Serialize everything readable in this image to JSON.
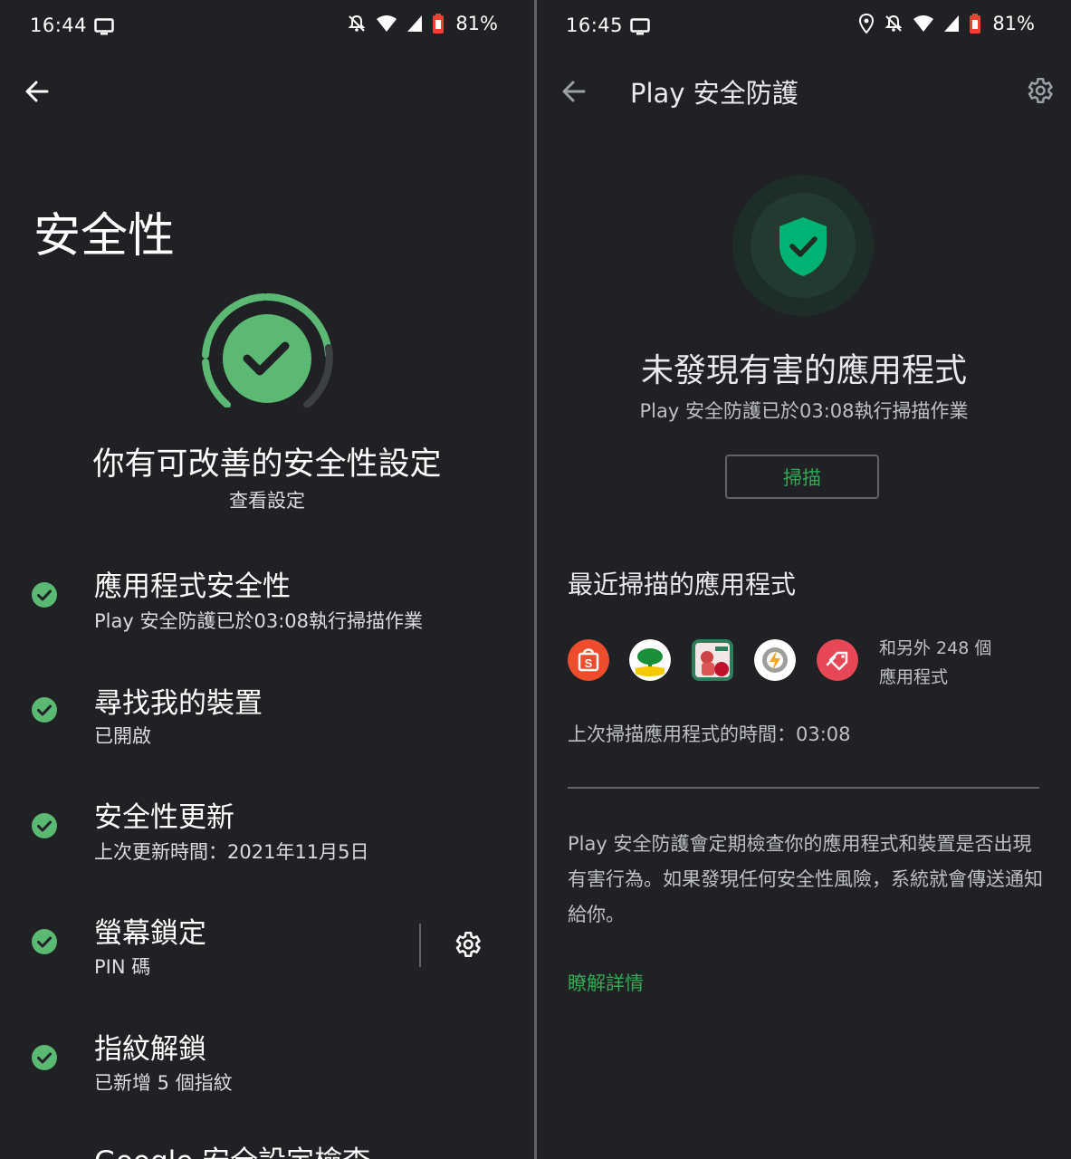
{
  "left_screen": {
    "status_bar": {
      "time": "16:44",
      "battery": "81%"
    },
    "title": "安全性",
    "summary": {
      "headline": "你有可改善的安全性設定",
      "link": "查看設定"
    },
    "items": [
      {
        "title": "應用程式安全性",
        "subtitle": "Play 安全防護已於03:08執行掃描作業",
        "status": "ok"
      },
      {
        "title": "尋找我的裝置",
        "subtitle": "已開啟",
        "status": "ok"
      },
      {
        "title": "安全性更新",
        "subtitle": "上次更新時間：2021年11月5日",
        "status": "ok"
      },
      {
        "title": "螢幕鎖定",
        "subtitle": "PIN 碼",
        "status": "ok",
        "has_settings": true
      },
      {
        "title": "指紋解鎖",
        "subtitle": "已新增 5 個指紋",
        "status": "ok"
      },
      {
        "title": "Google 安全設定檢查"
      }
    ]
  },
  "right_screen": {
    "status_bar": {
      "time": "16:45",
      "battery": "81%"
    },
    "app_bar": {
      "title": "Play 安全防護"
    },
    "status": {
      "headline": "未發現有害的應用程式",
      "subtitle": "Play 安全防護已於03:08執行掃描作業"
    },
    "scan_button": "掃描",
    "recent": {
      "title": "最近掃描的應用程式",
      "apps": [
        {
          "icon": "shopee-icon",
          "color": "#ee4d2d"
        },
        {
          "icon": "tree-bank-icon",
          "color": "#1a8f3a"
        },
        {
          "icon": "family-store-icon",
          "color": "#2e7d5b"
        },
        {
          "icon": "power-settings-icon",
          "color": "#f5a623"
        },
        {
          "icon": "coupon-tag-icon",
          "color": "#e84855"
        }
      ],
      "more_line1": "和另外 248 個",
      "more_line2": "應用程式"
    },
    "last_scan": "上次掃描應用程式的時間：03:08",
    "description": "Play 安全防護會定期檢查你的應用程式和裝置是否出現有害行為。如果發現任何安全性風險，系統就會傳送通知給你。",
    "learn_more": "瞭解詳情"
  },
  "colors": {
    "accent_green": "#34a853",
    "check_green": "#5bb974",
    "background": "#202124"
  }
}
